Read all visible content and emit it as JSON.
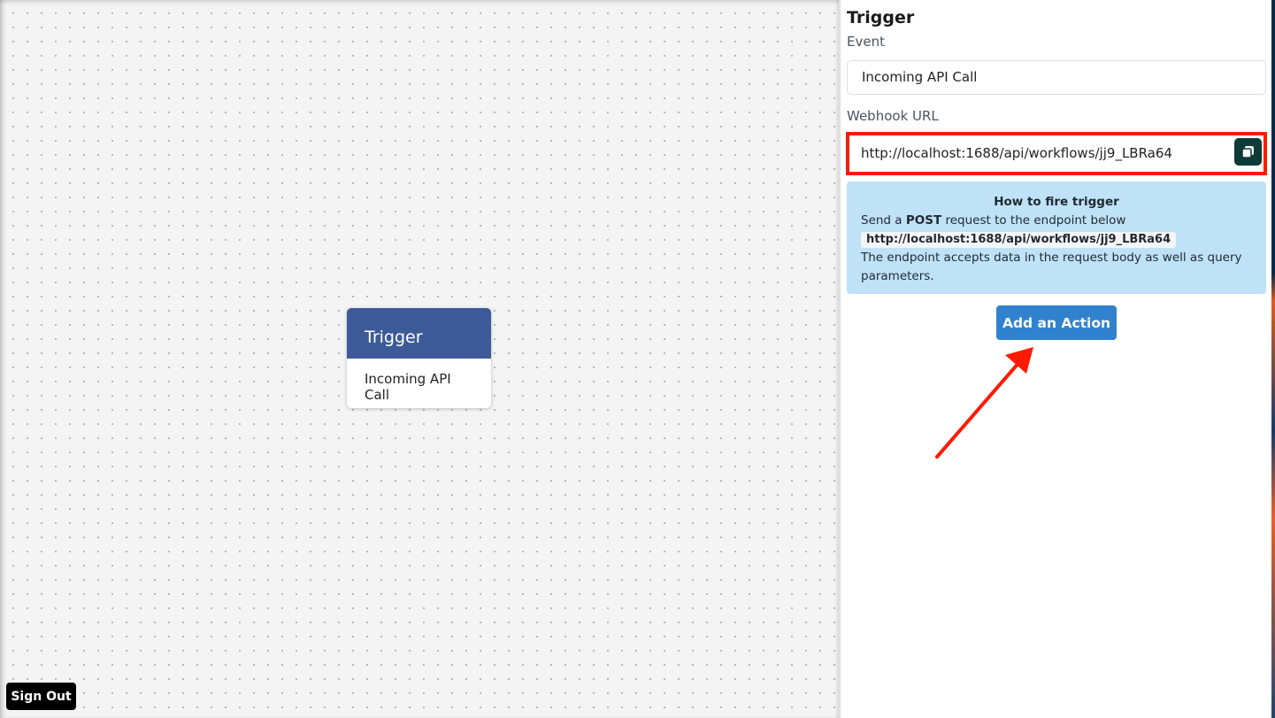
{
  "canvas": {
    "node": {
      "title": "Trigger",
      "subtitle": "Incoming API Call"
    },
    "sign_out_label": "Sign Out"
  },
  "panel": {
    "title": "Trigger",
    "event": {
      "label": "Event",
      "value": "Incoming API Call"
    },
    "webhook": {
      "label": "Webhook URL",
      "value": "http://localhost:1688/api/workflows/jj9_LBRa64",
      "copy_icon": "copy-icon"
    },
    "info": {
      "title": "How to fire trigger",
      "line1_prefix": "Send a ",
      "line1_method": "POST",
      "line1_suffix": " request to the endpoint below",
      "endpoint": "http://localhost:1688/api/workflows/jj9_LBRa64",
      "line3": "The endpoint accepts data in the request body as well as query parameters."
    },
    "add_action_label": "Add an Action"
  },
  "annotations": {
    "highlight_color": "#ff1a00"
  },
  "colors": {
    "node_header": "#3d5a98",
    "info_background": "#bfe2f7",
    "primary_button": "#3182ce",
    "copy_button": "#0e3b36"
  }
}
